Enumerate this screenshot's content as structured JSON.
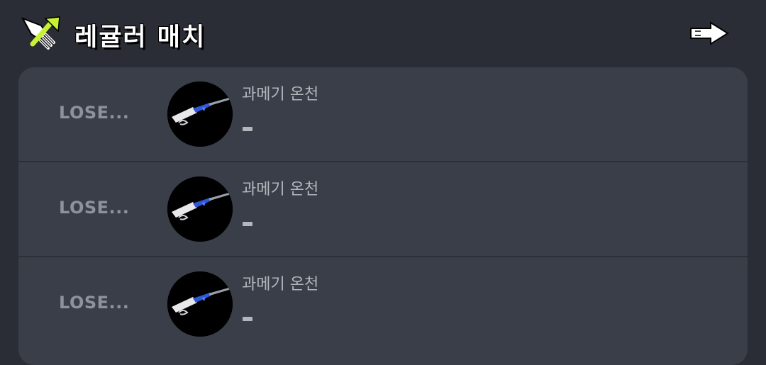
{
  "header": {
    "title": "레귤러 매치",
    "mode_icon": "regular-battle-icon",
    "next_icon": "arrow-right-icon"
  },
  "colors": {
    "background": "#2a2d35",
    "card": "#393e48",
    "accent_green": "#c9f233",
    "lose_text": "#8e939b"
  },
  "matches": [
    {
      "result": "LOSE...",
      "stage": "과메기 온천",
      "score": "-",
      "weapon_icon": "splattershot-jr-icon"
    },
    {
      "result": "LOSE...",
      "stage": "과메기 온천",
      "score": "-",
      "weapon_icon": "splattershot-jr-icon"
    },
    {
      "result": "LOSE...",
      "stage": "과메기 온천",
      "score": "-",
      "weapon_icon": "splattershot-jr-icon"
    }
  ]
}
